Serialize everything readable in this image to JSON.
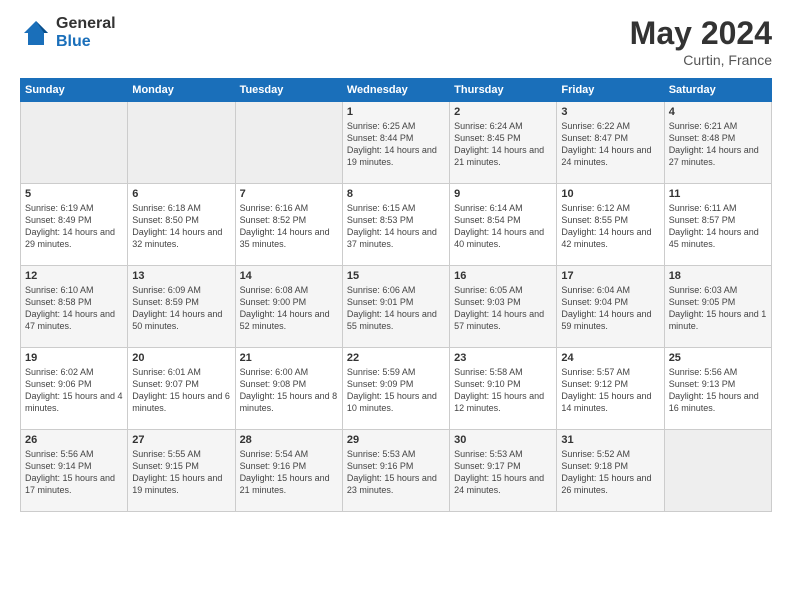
{
  "logo": {
    "general": "General",
    "blue": "Blue"
  },
  "header": {
    "month_year": "May 2024",
    "location": "Curtin, France"
  },
  "weekdays": [
    "Sunday",
    "Monday",
    "Tuesday",
    "Wednesday",
    "Thursday",
    "Friday",
    "Saturday"
  ],
  "weeks": [
    [
      {
        "day": "",
        "detail": ""
      },
      {
        "day": "",
        "detail": ""
      },
      {
        "day": "",
        "detail": ""
      },
      {
        "day": "1",
        "detail": "Sunrise: 6:25 AM\nSunset: 8:44 PM\nDaylight: 14 hours\nand 19 minutes."
      },
      {
        "day": "2",
        "detail": "Sunrise: 6:24 AM\nSunset: 8:45 PM\nDaylight: 14 hours\nand 21 minutes."
      },
      {
        "day": "3",
        "detail": "Sunrise: 6:22 AM\nSunset: 8:47 PM\nDaylight: 14 hours\nand 24 minutes."
      },
      {
        "day": "4",
        "detail": "Sunrise: 6:21 AM\nSunset: 8:48 PM\nDaylight: 14 hours\nand 27 minutes."
      }
    ],
    [
      {
        "day": "5",
        "detail": "Sunrise: 6:19 AM\nSunset: 8:49 PM\nDaylight: 14 hours\nand 29 minutes."
      },
      {
        "day": "6",
        "detail": "Sunrise: 6:18 AM\nSunset: 8:50 PM\nDaylight: 14 hours\nand 32 minutes."
      },
      {
        "day": "7",
        "detail": "Sunrise: 6:16 AM\nSunset: 8:52 PM\nDaylight: 14 hours\nand 35 minutes."
      },
      {
        "day": "8",
        "detail": "Sunrise: 6:15 AM\nSunset: 8:53 PM\nDaylight: 14 hours\nand 37 minutes."
      },
      {
        "day": "9",
        "detail": "Sunrise: 6:14 AM\nSunset: 8:54 PM\nDaylight: 14 hours\nand 40 minutes."
      },
      {
        "day": "10",
        "detail": "Sunrise: 6:12 AM\nSunset: 8:55 PM\nDaylight: 14 hours\nand 42 minutes."
      },
      {
        "day": "11",
        "detail": "Sunrise: 6:11 AM\nSunset: 8:57 PM\nDaylight: 14 hours\nand 45 minutes."
      }
    ],
    [
      {
        "day": "12",
        "detail": "Sunrise: 6:10 AM\nSunset: 8:58 PM\nDaylight: 14 hours\nand 47 minutes."
      },
      {
        "day": "13",
        "detail": "Sunrise: 6:09 AM\nSunset: 8:59 PM\nDaylight: 14 hours\nand 50 minutes."
      },
      {
        "day": "14",
        "detail": "Sunrise: 6:08 AM\nSunset: 9:00 PM\nDaylight: 14 hours\nand 52 minutes."
      },
      {
        "day": "15",
        "detail": "Sunrise: 6:06 AM\nSunset: 9:01 PM\nDaylight: 14 hours\nand 55 minutes."
      },
      {
        "day": "16",
        "detail": "Sunrise: 6:05 AM\nSunset: 9:03 PM\nDaylight: 14 hours\nand 57 minutes."
      },
      {
        "day": "17",
        "detail": "Sunrise: 6:04 AM\nSunset: 9:04 PM\nDaylight: 14 hours\nand 59 minutes."
      },
      {
        "day": "18",
        "detail": "Sunrise: 6:03 AM\nSunset: 9:05 PM\nDaylight: 15 hours\nand 1 minute."
      }
    ],
    [
      {
        "day": "19",
        "detail": "Sunrise: 6:02 AM\nSunset: 9:06 PM\nDaylight: 15 hours\nand 4 minutes."
      },
      {
        "day": "20",
        "detail": "Sunrise: 6:01 AM\nSunset: 9:07 PM\nDaylight: 15 hours\nand 6 minutes."
      },
      {
        "day": "21",
        "detail": "Sunrise: 6:00 AM\nSunset: 9:08 PM\nDaylight: 15 hours\nand 8 minutes."
      },
      {
        "day": "22",
        "detail": "Sunrise: 5:59 AM\nSunset: 9:09 PM\nDaylight: 15 hours\nand 10 minutes."
      },
      {
        "day": "23",
        "detail": "Sunrise: 5:58 AM\nSunset: 9:10 PM\nDaylight: 15 hours\nand 12 minutes."
      },
      {
        "day": "24",
        "detail": "Sunrise: 5:57 AM\nSunset: 9:12 PM\nDaylight: 15 hours\nand 14 minutes."
      },
      {
        "day": "25",
        "detail": "Sunrise: 5:56 AM\nSunset: 9:13 PM\nDaylight: 15 hours\nand 16 minutes."
      }
    ],
    [
      {
        "day": "26",
        "detail": "Sunrise: 5:56 AM\nSunset: 9:14 PM\nDaylight: 15 hours\nand 17 minutes."
      },
      {
        "day": "27",
        "detail": "Sunrise: 5:55 AM\nSunset: 9:15 PM\nDaylight: 15 hours\nand 19 minutes."
      },
      {
        "day": "28",
        "detail": "Sunrise: 5:54 AM\nSunset: 9:16 PM\nDaylight: 15 hours\nand 21 minutes."
      },
      {
        "day": "29",
        "detail": "Sunrise: 5:53 AM\nSunset: 9:16 PM\nDaylight: 15 hours\nand 23 minutes."
      },
      {
        "day": "30",
        "detail": "Sunrise: 5:53 AM\nSunset: 9:17 PM\nDaylight: 15 hours\nand 24 minutes."
      },
      {
        "day": "31",
        "detail": "Sunrise: 5:52 AM\nSunset: 9:18 PM\nDaylight: 15 hours\nand 26 minutes."
      },
      {
        "day": "",
        "detail": ""
      }
    ]
  ]
}
